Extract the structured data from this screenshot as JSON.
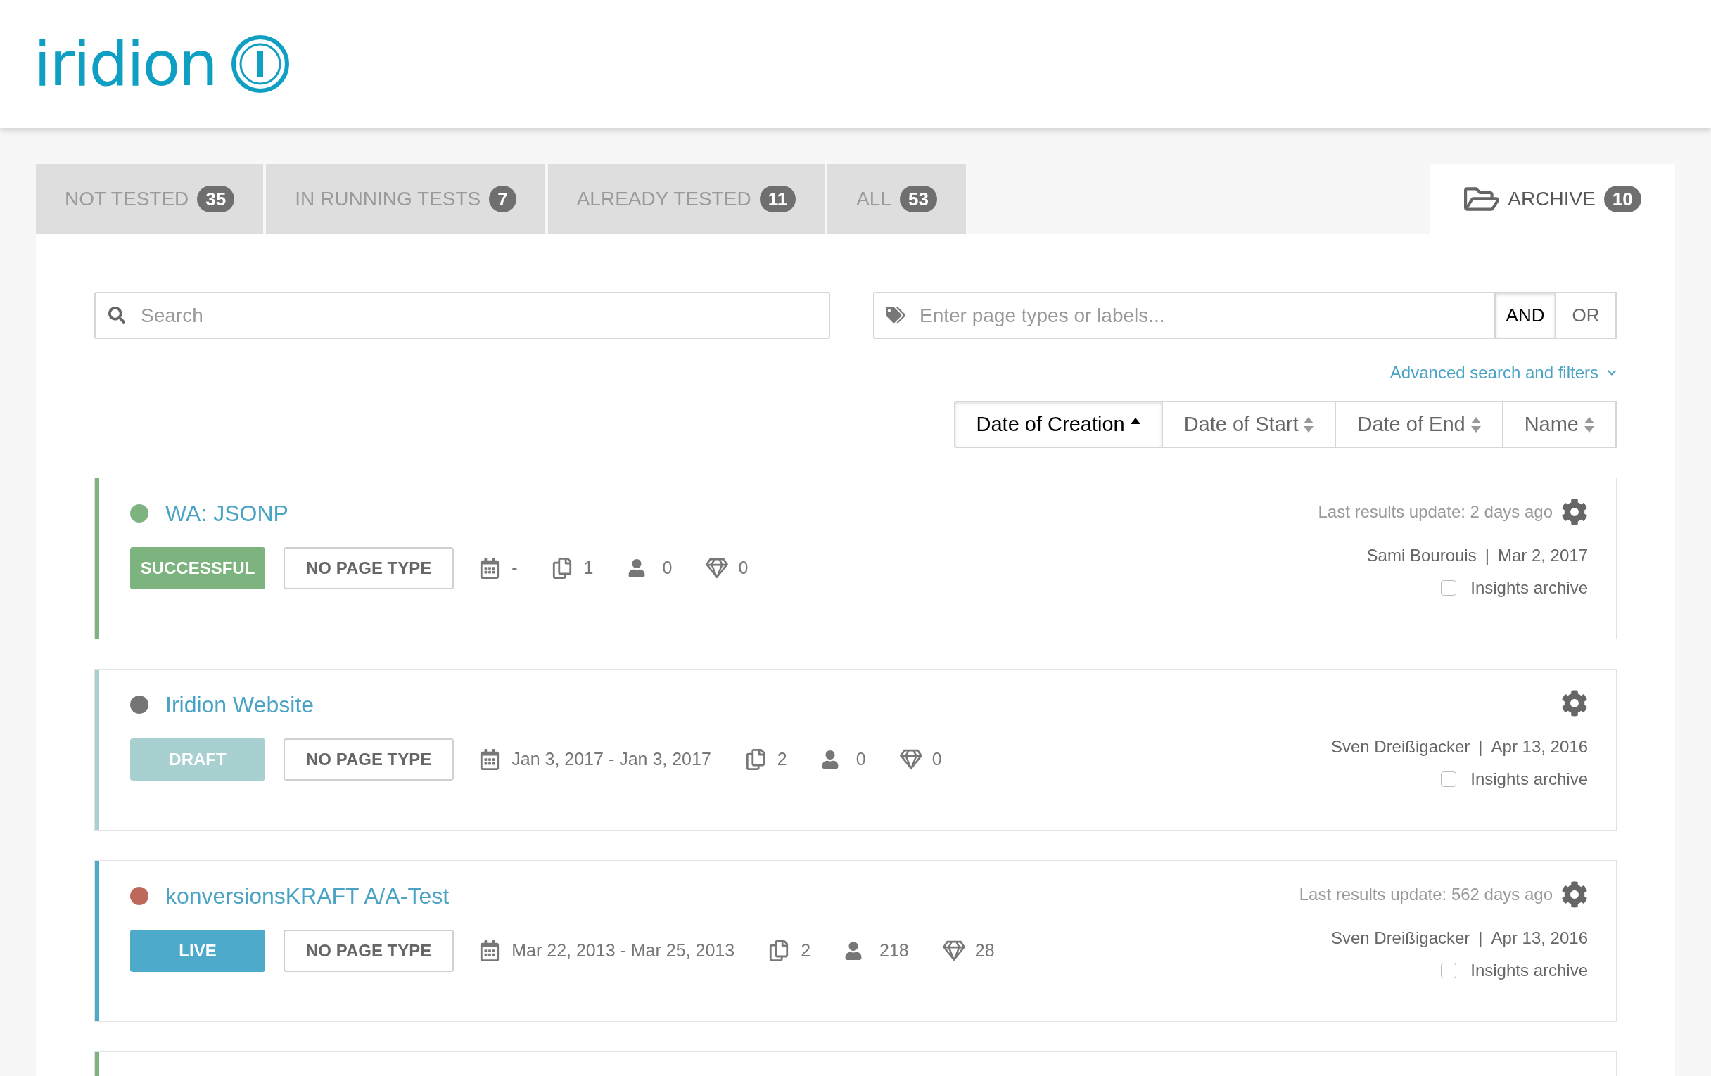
{
  "logo": {
    "text": "iridion"
  },
  "tabs": [
    {
      "label": "NOT TESTED",
      "count": "35",
      "selected": false
    },
    {
      "label": "IN RUNNING TESTS",
      "count": "7",
      "selected": false
    },
    {
      "label": "ALREADY TESTED",
      "count": "11",
      "selected": false
    },
    {
      "label": "ALL",
      "count": "53",
      "selected": false
    }
  ],
  "archive_tab": {
    "label": "ARCHIVE",
    "count": "10",
    "selected": true
  },
  "search": {
    "placeholder": "Search"
  },
  "label_filter": {
    "placeholder": "Enter page types or labels...",
    "operators": [
      {
        "label": "AND",
        "selected": true
      },
      {
        "label": "OR",
        "selected": false
      }
    ]
  },
  "advanced_link": "Advanced search and filters",
  "sort_buttons": [
    {
      "label": "Date of Creation",
      "selected": true
    },
    {
      "label": "Date of Start",
      "selected": false
    },
    {
      "label": "Date of End",
      "selected": false
    },
    {
      "label": "Name",
      "selected": false
    }
  ],
  "tests": [
    {
      "name": "WA: JSONP",
      "color": "#7db37f",
      "separator": "|",
      "status": {
        "label": "SUCCESSFUL",
        "color": "#7db37f"
      },
      "page_type": "NO PAGE TYPE",
      "dates": "-",
      "variants": "1",
      "visitors": "0",
      "goals": "0",
      "last_update": "Last results update: 2 days ago",
      "author": "Sami Bourouis",
      "created": "Mar 2, 2017",
      "archive": {
        "label": "Insights archive",
        "checked": false
      }
    },
    {
      "name": "Iridion Website",
      "color": "#757575",
      "separator": "|",
      "status": {
        "label": "DRAFT",
        "color": "#a8d0d0"
      },
      "page_type": "NO PAGE TYPE",
      "dates": "Jan 3, 2017 - Jan 3, 2017",
      "variants": "2",
      "visitors": "0",
      "goals": "0",
      "author": "Sven Dreißigacker",
      "created": "Apr 13, 2016",
      "archive": {
        "label": "Insights archive",
        "checked": false
      }
    },
    {
      "name": "konversionsKRAFT A/A-Test",
      "color": "#c0675c",
      "separator": "|",
      "status": {
        "label": "LIVE",
        "color": "#4daacb"
      },
      "page_type": "NO PAGE TYPE",
      "dates": "Mar 22, 2013 - Mar 25, 2013",
      "variants": "2",
      "visitors": "218",
      "goals": "28",
      "last_update": "Last results update: 562 days ago",
      "author": "Sven Dreißigacker",
      "created": "Apr 13, 2016",
      "archive": {
        "label": "Insights archive",
        "checked": false
      }
    }
  ],
  "next_card": {
    "color": "#7db37f"
  }
}
